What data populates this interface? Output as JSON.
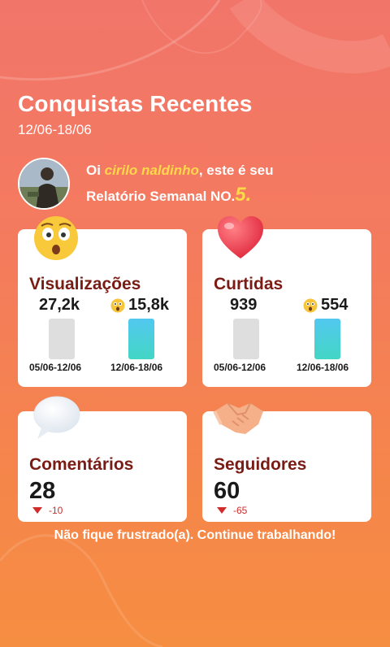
{
  "header": {
    "title": "Conquistas Recentes",
    "date_range": "12/06-18/06"
  },
  "greeting": {
    "prefix": "Oi ",
    "username": "cirilo naldinho",
    "suffix": ", este é seu",
    "line2": "Relatório Semanal NO.",
    "report_number": "5",
    "period": "."
  },
  "cards": {
    "views": {
      "title": "Visualizações",
      "prev_value": "27,2k",
      "curr_value": "15,8k",
      "prev_label": "05/06-12/06",
      "curr_label": "12/06-18/06",
      "icon": "astonished-face-icon"
    },
    "likes": {
      "title": "Curtidas",
      "prev_value": "939",
      "curr_value": "554",
      "prev_label": "05/06-12/06",
      "curr_label": "12/06-18/06",
      "icon": "heart-icon"
    },
    "comments": {
      "title": "Comentários",
      "value": "28",
      "delta": "-10",
      "icon": "speech-bubble-icon"
    },
    "followers": {
      "title": "Seguidores",
      "value": "60",
      "delta": "-65",
      "icon": "handshake-icon"
    }
  },
  "footer": {
    "message": "Não fique frustrado(a). Continue trabalhando!"
  },
  "colors": {
    "accent_yellow": "#ffd84a",
    "title_maroon": "#7a1c14",
    "negative_red": "#d22b2b",
    "bar_new": "#52c8f0",
    "bar_old": "#dedede"
  }
}
